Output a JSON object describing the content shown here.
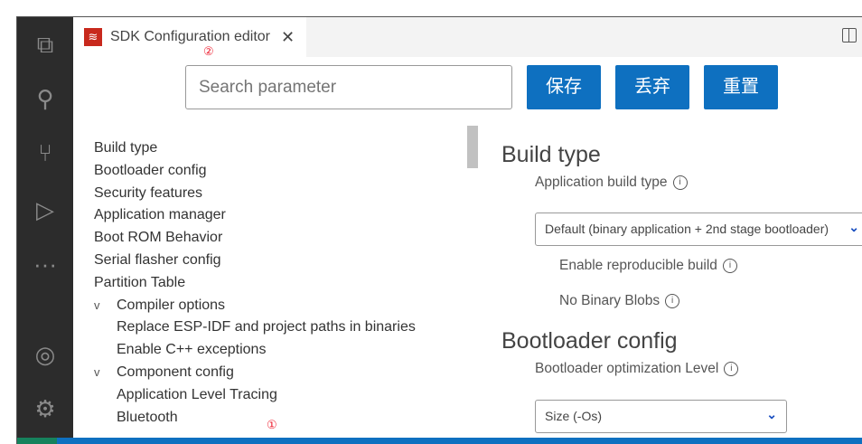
{
  "tab": {
    "title": "SDK Configuration editor",
    "close": "✕",
    "annotation": "②"
  },
  "search": {
    "placeholder": "Search parameter"
  },
  "buttons": {
    "save": "保存",
    "discard": "丢弃",
    "reset": "重置"
  },
  "tree": [
    {
      "label": "Build type"
    },
    {
      "label": "Bootloader config"
    },
    {
      "label": "Security features"
    },
    {
      "label": "Application manager"
    },
    {
      "label": "Boot ROM Behavior"
    },
    {
      "label": "Serial flasher config"
    },
    {
      "label": "Partition Table"
    },
    {
      "label": "Compiler options"
    },
    {
      "label": "Replace ESP-IDF and project paths in binaries"
    },
    {
      "label": "Enable C++ exceptions"
    },
    {
      "label": "Component config"
    },
    {
      "label": "Application Level Tracing"
    },
    {
      "label": "Bluetooth"
    }
  ],
  "chevron": "v",
  "annotation1": "①",
  "right": {
    "build_type_heading": "Build type",
    "app_build_type_label": "Application build type",
    "app_build_type_value": "Default (binary application + 2nd stage bootloader)",
    "reproducible": "Enable reproducible build",
    "no_blobs": "No Binary Blobs",
    "bootloader_heading": "Bootloader config",
    "opt_level_label": "Bootloader optimization Level",
    "opt_level_value": "Size (-Os)",
    "info": "i"
  }
}
